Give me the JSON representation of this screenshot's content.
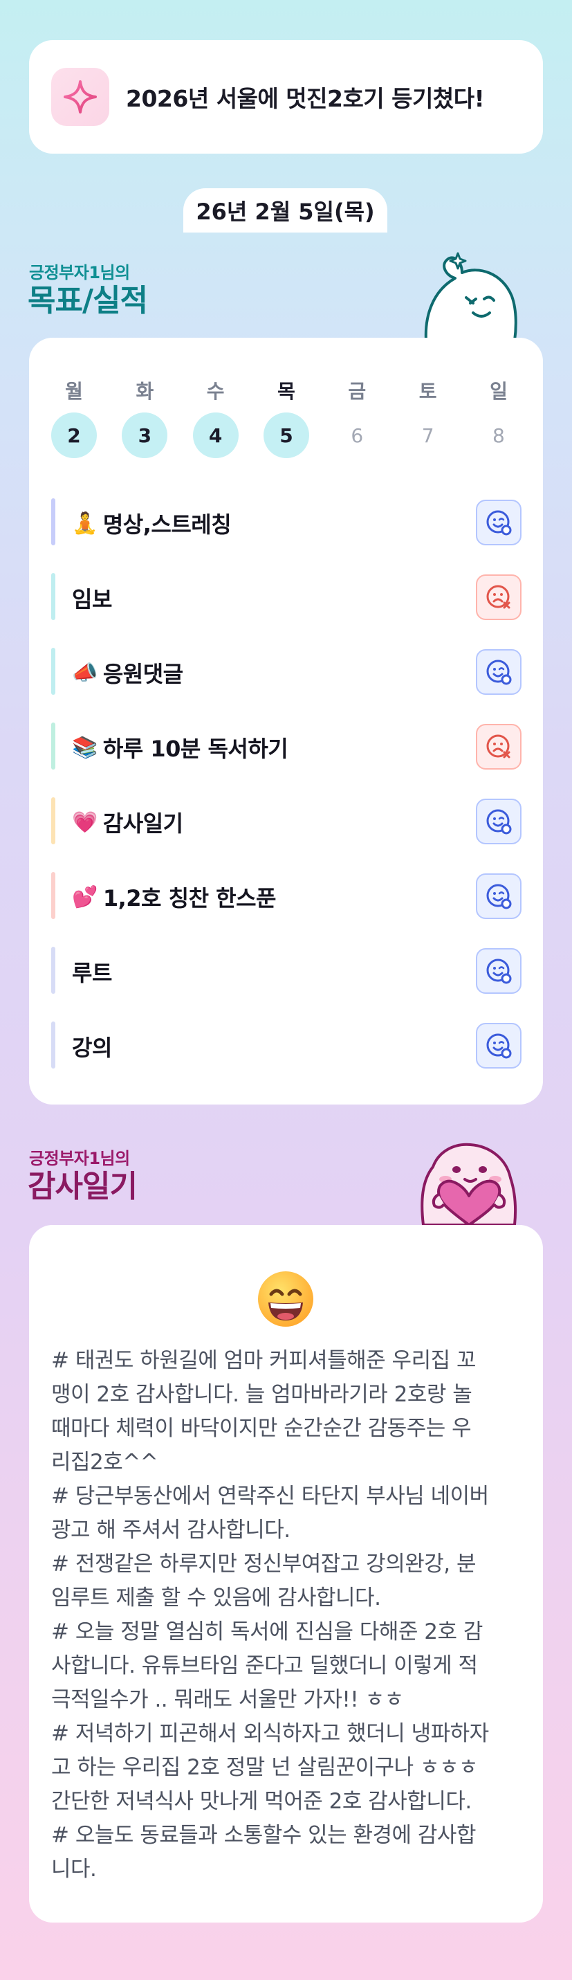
{
  "banner": {
    "icon": "sparkle-icon",
    "title": "2026년 서울에 멋진2호기 등기쳤다!"
  },
  "date": "26년 2월 5일(목)",
  "goals_section": {
    "subtitle": "긍정부자1님의",
    "title": "목표/실적"
  },
  "week": {
    "days": [
      "월",
      "화",
      "수",
      "목",
      "금",
      "토",
      "일"
    ],
    "dates": [
      "2",
      "3",
      "4",
      "5",
      "6",
      "7",
      "8"
    ],
    "completed_count": 4,
    "today_index": 3
  },
  "tasks": [
    {
      "emoji": "🧘",
      "label": "명상,스트레칭",
      "status": "success",
      "bar_color": "#c7cdfa"
    },
    {
      "emoji": "",
      "label": "임보",
      "status": "fail",
      "bar_color": "#bfeef0"
    },
    {
      "emoji": "📣",
      "label": "응원댓글",
      "status": "success",
      "bar_color": "#bfeef0"
    },
    {
      "emoji": "📚",
      "label": "하루 10분 독서하기",
      "status": "fail",
      "bar_color": "#bfefe0"
    },
    {
      "emoji": "💗",
      "label": "감사일기",
      "status": "success",
      "bar_color": "#fde3b4"
    },
    {
      "emoji": "💕",
      "label": "1,2호 칭찬 한스푼",
      "status": "success",
      "bar_color": "#fcd0cc"
    },
    {
      "emoji": "",
      "label": "루트",
      "status": "success",
      "bar_color": "#d7dcf6"
    },
    {
      "emoji": "",
      "label": "강의",
      "status": "success",
      "bar_color": "#d7dcf6"
    }
  ],
  "diary_section": {
    "subtitle": "긍정부자1님의",
    "title": "감사일기"
  },
  "diary": {
    "mood_icon": "grinning-face-icon",
    "text": "# 태권도 하원길에 엄마 커피셔틀해준 우리집 꼬\n맹이 2호 감사합니다. 늘 엄마바라기라 2호랑 놀\n때마다 체력이 바닥이지만 순간순간 감동주는 우\n리집2호^^\n# 당근부동산에서 연락주신 타단지 부사님 네이버\n광고 해 주셔서 감사합니다.\n# 전쟁같은 하루지만 정신부여잡고 강의완강, 분\n임루트 제출 할 수 있음에 감사합니다.\n# 오늘 정말 열심히 독서에 진심을 다해준 2호 감\n사합니다. 유튜브타임 준다고 딜했더니 이렇게 적\n극적일수가 .. 뭐래도 서울만 가자!! ㅎㅎ\n# 저녁하기 피곤해서 외식하자고 했더니 냉파하자\n고 하는 우리집 2호 정말 넌 살림꾼이구나 ㅎㅎㅎ\n간단한 저녁식사 맛나게 먹어준 2호 감사합니다.\n# 오늘도 동료들과 소통할수 있는 환경에 감사합\n니다."
  },
  "colors": {
    "success_icon": "#3b5bdb",
    "fail_icon": "#e2554a",
    "done_circle": "#c5f0f4",
    "goals_title": "#0d7f86",
    "diary_title": "#8a1a61"
  }
}
